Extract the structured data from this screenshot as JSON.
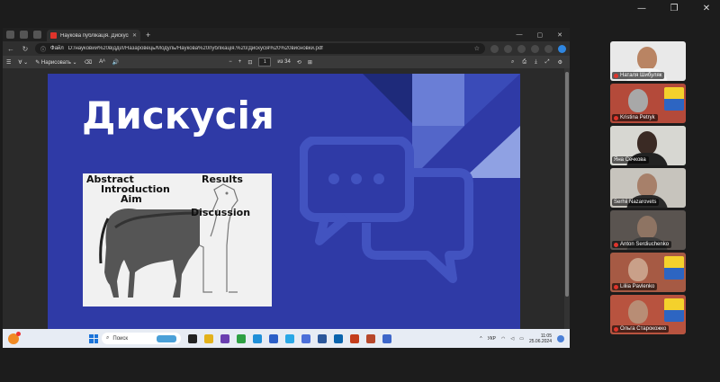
{
  "outer_window": {
    "controls": [
      "—",
      "❐",
      "✕"
    ]
  },
  "browser": {
    "tab_title": "Наукова публікація. Дискусія і в",
    "address_label": "Файл",
    "address_url": "D:/науковий%20відділ/Назаровець/Модуль/Наукова%20публікація.%20/Дискусія%20%20висновки.pdf",
    "pdf_toolbar": {
      "draw_label": "Нарисовать",
      "aa_label": "Aᴬ",
      "page_current": "1",
      "page_total": "из 34"
    }
  },
  "slide": {
    "title": "Дискусія",
    "meme_labels": [
      "Abstract",
      "Introduction",
      "Aim",
      "Results",
      "Discussion"
    ]
  },
  "taskbar": {
    "search_placeholder": "Поиск",
    "language": "УКР",
    "time": "11:05",
    "date": "25.06.2024"
  },
  "participants": [
    {
      "name": "Наталя Шибуляк",
      "muted": true
    },
    {
      "name": "Kristina Petryk",
      "muted": true
    },
    {
      "name": "Яна Сечкова",
      "muted": false,
      "active": true
    },
    {
      "name": "Serhii Nazarovets",
      "muted": false
    },
    {
      "name": "Anton Serdiuchenko",
      "muted": true
    },
    {
      "name": "Liliia Pavlenko",
      "muted": true
    },
    {
      "name": "Ольга Старокожко",
      "muted": true
    }
  ]
}
